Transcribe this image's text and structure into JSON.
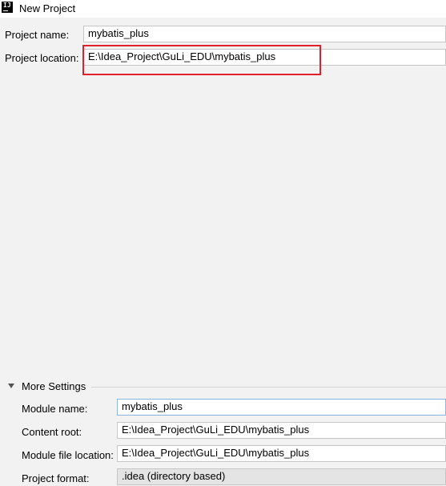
{
  "window": {
    "title": "New Project",
    "icon": "intellij-idea-icon"
  },
  "form": {
    "project_name_label": "Project name:",
    "project_name_value": "mybatis_plus",
    "project_location_label": "Project location:",
    "project_location_value": "E:\\Idea_Project\\GuLi_EDU\\mybatis_plus"
  },
  "more_settings": {
    "label": "More Settings",
    "expanded": true,
    "module_name_label": "Module name:",
    "module_name_value": "mybatis_plus",
    "content_root_label": "Content root:",
    "content_root_value": "E:\\Idea_Project\\GuLi_EDU\\mybatis_plus",
    "module_file_location_label": "Module file location:",
    "module_file_location_value": "E:\\Idea_Project\\GuLi_EDU\\mybatis_plus",
    "project_format_label": "Project format:",
    "project_format_value": ".idea (directory based)"
  },
  "colors": {
    "background": "#f2f2f2",
    "highlight": "#e0202a",
    "focus_border": "#8eb4dd"
  }
}
